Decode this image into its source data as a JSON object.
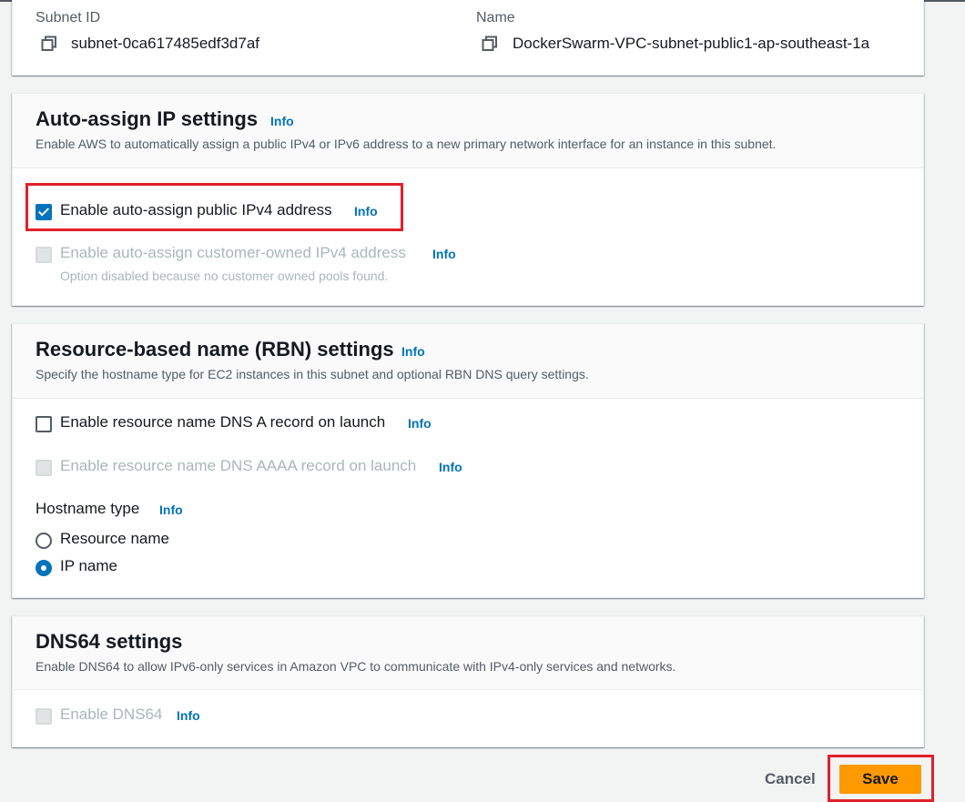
{
  "subnet_details": {
    "subnet_id_label": "Subnet ID",
    "subnet_id_value": "subnet-0ca617485edf3d7af",
    "name_label": "Name",
    "name_value": "DockerSwarm-VPC-subnet-public1-ap-southeast-1a"
  },
  "auto_assign": {
    "title": "Auto-assign IP settings",
    "info": "Info",
    "description": "Enable AWS to automatically assign a public IPv4 or IPv6 address to a new primary network interface for an instance in this subnet.",
    "public_ipv4_label": "Enable auto-assign public IPv4 address",
    "public_ipv4_checked": true,
    "public_ipv4_info": "Info",
    "customer_owned_label": "Enable auto-assign customer-owned IPv4 address",
    "customer_owned_info": "Info",
    "customer_owned_note": "Option disabled because no customer owned pools found."
  },
  "rbn": {
    "title": "Resource-based name (RBN) settings",
    "info": "Info",
    "description": "Specify the hostname type for EC2 instances in this subnet and optional RBN DNS query settings.",
    "dns_a_label": "Enable resource name DNS A record on launch",
    "dns_a_info": "Info",
    "dns_aaaa_label": "Enable resource name DNS AAAA record on launch",
    "dns_aaaa_info": "Info",
    "hostname_type_label": "Hostname type",
    "hostname_type_info": "Info",
    "options": [
      "Resource name",
      "IP name"
    ],
    "selected": "IP name"
  },
  "dns64": {
    "title": "DNS64 settings",
    "description": "Enable DNS64 to allow IPv6-only services in Amazon VPC to communicate with IPv4-only services and networks.",
    "enable_label": "Enable DNS64",
    "enable_info": "Info"
  },
  "footer": {
    "cancel_label": "Cancel",
    "save_label": "Save"
  },
  "colors": {
    "accent": "#0073bb",
    "save_button": "#ff9900",
    "highlight": "#e0202b"
  }
}
